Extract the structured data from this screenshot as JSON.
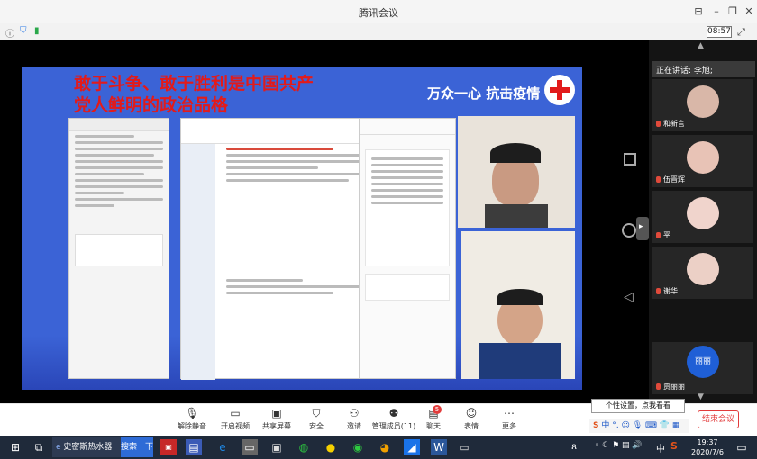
{
  "window": {
    "title": "腾讯会议",
    "clock": "08:57"
  },
  "slide": {
    "headline": "敢于斗争、敢于胜利是中国共产党人鲜明的政治品格",
    "slogan": "万众一心 抗击疫情"
  },
  "sidebar": {
    "speaking_label": "正在讲话: 李旭;",
    "participants": [
      {
        "name": "和新言"
      },
      {
        "name": "伍晋辉"
      },
      {
        "name": "平"
      },
      {
        "name": "谢华"
      },
      {
        "name": "贾丽丽",
        "avatar_text": "丽丽"
      }
    ]
  },
  "toolbar": {
    "buttons": [
      {
        "label": "解除静音",
        "icon": "mic-muted-icon"
      },
      {
        "label": "开启视频",
        "icon": "camera-off-icon"
      },
      {
        "label": "共享屏幕",
        "icon": "screen-share-icon"
      },
      {
        "label": "安全",
        "icon": "shield-icon"
      },
      {
        "label": "邀请",
        "icon": "invite-icon"
      },
      {
        "label": "管理成员(11)",
        "icon": "members-icon"
      },
      {
        "label": "聊天",
        "icon": "chat-icon"
      },
      {
        "label": "表情",
        "icon": "emoji-icon"
      },
      {
        "label": "更多",
        "icon": "more-icon"
      }
    ],
    "chat_badge": "5",
    "end_label": "结束会议",
    "tooltip": "个性设置，点我看看",
    "ime_label": "中"
  },
  "taskbar": {
    "search_text": "史密斯热水器",
    "search_button": "搜索一下",
    "time": "19:37",
    "date": "2020/7/6",
    "tray_lang": "中"
  },
  "colors": {
    "accent": "#e21b1b",
    "slide_bg": "#3b63d6",
    "end_red": "#e23b3b"
  }
}
